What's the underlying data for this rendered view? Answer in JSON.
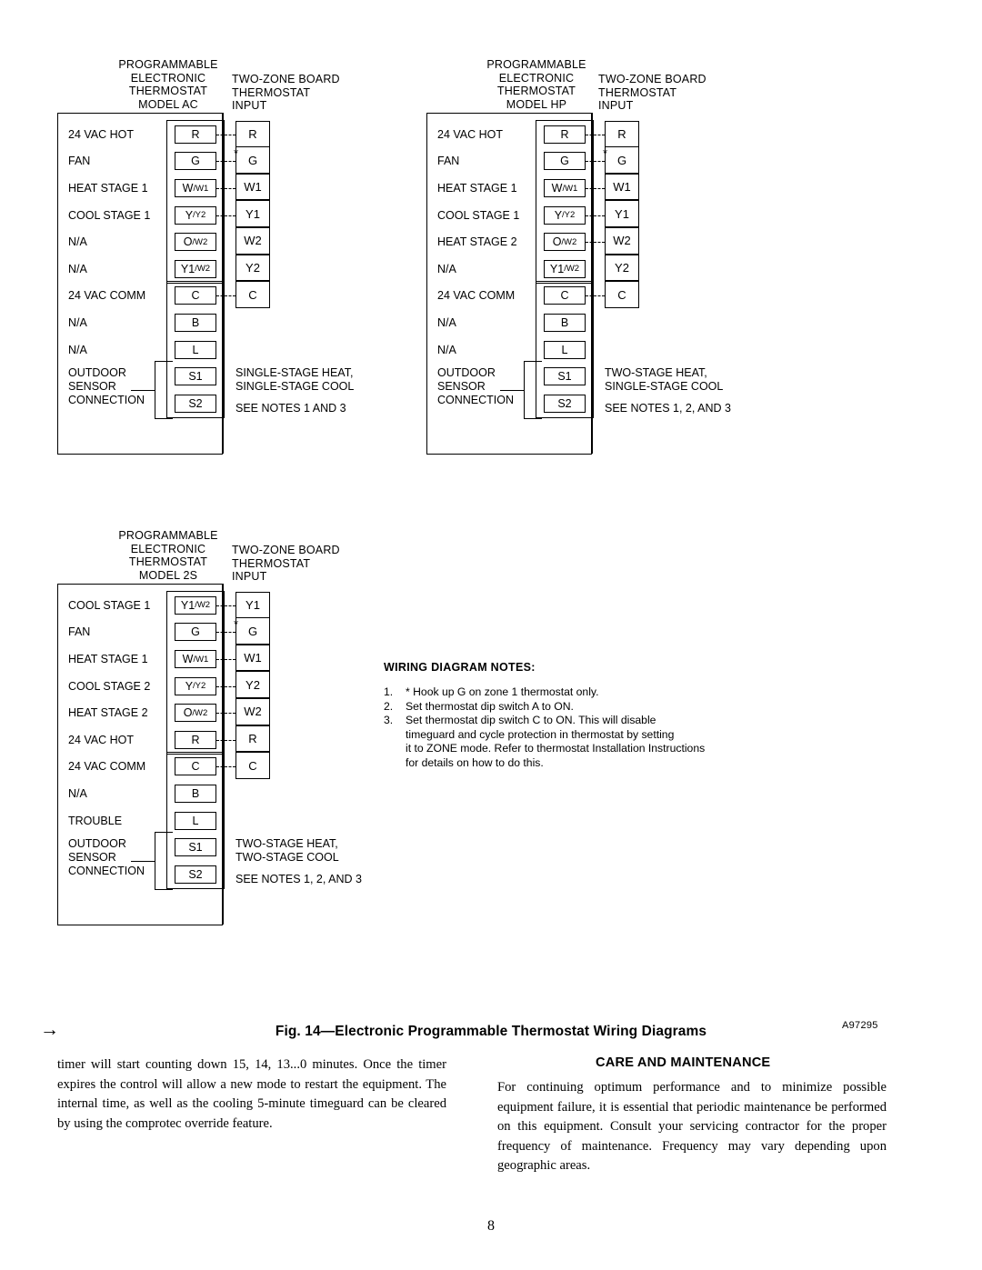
{
  "diagrams": [
    {
      "id": "model-ac",
      "header_left": "PROGRAMMABLE\nELECTRONIC\nTHERMOSTAT\nMODEL AC",
      "header_right": "TWO-ZONE BOARD\nTHERMOSTAT\nINPUT",
      "rows": [
        {
          "label": "24 VAC HOT",
          "term_main": "R",
          "term_sub": "",
          "input": "R",
          "wire": true,
          "star": false
        },
        {
          "label": "FAN",
          "term_main": "G",
          "term_sub": "",
          "input": "G",
          "wire": true,
          "star": true
        },
        {
          "label": "HEAT STAGE 1",
          "term_main": "W",
          "term_sub": "/W1",
          "input": "W1",
          "wire": true,
          "star": false
        },
        {
          "label": "COOL STAGE 1",
          "term_main": "Y",
          "term_sub": "/Y2",
          "input": "Y1",
          "wire": true,
          "star": false
        },
        {
          "label": "N/A",
          "term_main": "O",
          "term_sub": "/W2",
          "input": "W2",
          "wire": false,
          "star": false
        },
        {
          "label": "N/A",
          "term_main": "Y1",
          "term_sub": "/W2",
          "input": "Y2",
          "wire": false,
          "star": false
        },
        {
          "label": "24 VAC COMM",
          "term_main": "C",
          "term_sub": "",
          "input": "C",
          "wire": true,
          "star": false
        },
        {
          "label": "N/A",
          "term_main": "B",
          "term_sub": "",
          "input": "",
          "wire": false,
          "star": false
        },
        {
          "label": "N/A",
          "term_main": "L",
          "term_sub": "",
          "input": "",
          "wire": false,
          "star": false
        },
        {
          "label": "",
          "term_main": "S1",
          "term_sub": "",
          "input": "",
          "wire": false,
          "star": false
        },
        {
          "label": "",
          "term_main": "S2",
          "term_sub": "",
          "input": "",
          "wire": false,
          "star": false
        }
      ],
      "sensor_label": "OUTDOOR\nSENSOR\nCONNECTION",
      "capability": "SINGLE-STAGE HEAT,\nSINGLE-STAGE COOL",
      "see_notes": "SEE NOTES 1 AND 3"
    },
    {
      "id": "model-hp",
      "header_left": "PROGRAMMABLE\nELECTRONIC\nTHERMOSTAT\nMODEL HP",
      "header_right": "TWO-ZONE BOARD\nTHERMOSTAT\nINPUT",
      "rows": [
        {
          "label": "24 VAC HOT",
          "term_main": "R",
          "term_sub": "",
          "input": "R",
          "wire": true,
          "star": false
        },
        {
          "label": "FAN",
          "term_main": "G",
          "term_sub": "",
          "input": "G",
          "wire": true,
          "star": true
        },
        {
          "label": "HEAT STAGE 1",
          "term_main": "W",
          "term_sub": "/W1",
          "input": "W1",
          "wire": true,
          "star": false
        },
        {
          "label": "COOL STAGE 1",
          "term_main": "Y",
          "term_sub": "/Y2",
          "input": "Y1",
          "wire": true,
          "star": false
        },
        {
          "label": "HEAT STAGE 2",
          "term_main": "O",
          "term_sub": "/W2",
          "input": "W2",
          "wire": true,
          "star": false
        },
        {
          "label": "N/A",
          "term_main": "Y1",
          "term_sub": "/W2",
          "input": "Y2",
          "wire": false,
          "star": false
        },
        {
          "label": "24 VAC COMM",
          "term_main": "C",
          "term_sub": "",
          "input": "C",
          "wire": true,
          "star": false
        },
        {
          "label": "N/A",
          "term_main": "B",
          "term_sub": "",
          "input": "",
          "wire": false,
          "star": false
        },
        {
          "label": "N/A",
          "term_main": "L",
          "term_sub": "",
          "input": "",
          "wire": false,
          "star": false
        },
        {
          "label": "",
          "term_main": "S1",
          "term_sub": "",
          "input": "",
          "wire": false,
          "star": false
        },
        {
          "label": "",
          "term_main": "S2",
          "term_sub": "",
          "input": "",
          "wire": false,
          "star": false
        }
      ],
      "sensor_label": "OUTDOOR\nSENSOR\nCONNECTION",
      "capability": "TWO-STAGE HEAT,\nSINGLE-STAGE COOL",
      "see_notes": "SEE NOTES 1, 2, AND 3"
    },
    {
      "id": "model-2s",
      "header_left": "PROGRAMMABLE\nELECTRONIC\nTHERMOSTAT\nMODEL 2S",
      "header_right": "TWO-ZONE BOARD\nTHERMOSTAT\nINPUT",
      "rows": [
        {
          "label": "COOL STAGE 1",
          "term_main": "Y1",
          "term_sub": "/W2",
          "input": "Y1",
          "wire": true,
          "star": false
        },
        {
          "label": "FAN",
          "term_main": "G",
          "term_sub": "",
          "input": "G",
          "wire": true,
          "star": true
        },
        {
          "label": "HEAT STAGE 1",
          "term_main": "W",
          "term_sub": "/W1",
          "input": "W1",
          "wire": true,
          "star": false
        },
        {
          "label": "COOL STAGE 2",
          "term_main": "Y",
          "term_sub": "/Y2",
          "input": "Y2",
          "wire": true,
          "star": false
        },
        {
          "label": "HEAT STAGE 2",
          "term_main": "O",
          "term_sub": "/W2",
          "input": "W2",
          "wire": true,
          "star": false
        },
        {
          "label": "24 VAC HOT",
          "term_main": "R",
          "term_sub": "",
          "input": "R",
          "wire": true,
          "star": false
        },
        {
          "label": "24 VAC COMM",
          "term_main": "C",
          "term_sub": "",
          "input": "C",
          "wire": true,
          "star": false
        },
        {
          "label": "N/A",
          "term_main": "B",
          "term_sub": "",
          "input": "",
          "wire": false,
          "star": false
        },
        {
          "label": "TROUBLE",
          "term_main": "L",
          "term_sub": "",
          "input": "",
          "wire": false,
          "star": false
        },
        {
          "label": "",
          "term_main": "S1",
          "term_sub": "",
          "input": "",
          "wire": false,
          "star": false
        },
        {
          "label": "",
          "term_main": "S2",
          "term_sub": "",
          "input": "",
          "wire": false,
          "star": false
        }
      ],
      "sensor_label": "OUTDOOR\nSENSOR\nCONNECTION",
      "capability": "TWO-STAGE HEAT,\nTWO-STAGE COOL",
      "see_notes": "SEE NOTES 1, 2, AND 3"
    }
  ],
  "wiring_notes": {
    "title": "WIRING DIAGRAM NOTES:",
    "items": [
      {
        "num": "1.",
        "text": "* Hook up G on zone 1 thermostat only."
      },
      {
        "num": "2.",
        "text": "Set thermostat dip switch A to ON."
      },
      {
        "num": "3.",
        "text": "Set thermostat dip switch C to ON.  This will disable\ntimeguard and cycle protection in thermostat by setting\nit to ZONE mode.  Refer to thermostat Installation Instructions\nfor details on how to do this."
      }
    ]
  },
  "figure": {
    "arrow": "→",
    "caption": "Fig. 14—Electronic Programmable Thermostat Wiring Diagrams",
    "code": "A97295"
  },
  "body": {
    "left_column": "timer will start counting down 15, 14, 13...0 minutes. Once the timer expires the control will allow a new mode to restart the equipment. The internal time, as well as the cooling 5-minute timeguard can be cleared by using the comprotec override feature.",
    "right_heading": "CARE AND MAINTENANCE",
    "right_column": "For continuing optimum performance and to minimize possible equipment failure, it is essential that periodic maintenance be performed on this equipment. Consult your servicing contractor for the proper frequency of maintenance. Frequency may vary depending upon geographic areas."
  },
  "page_number": "8"
}
